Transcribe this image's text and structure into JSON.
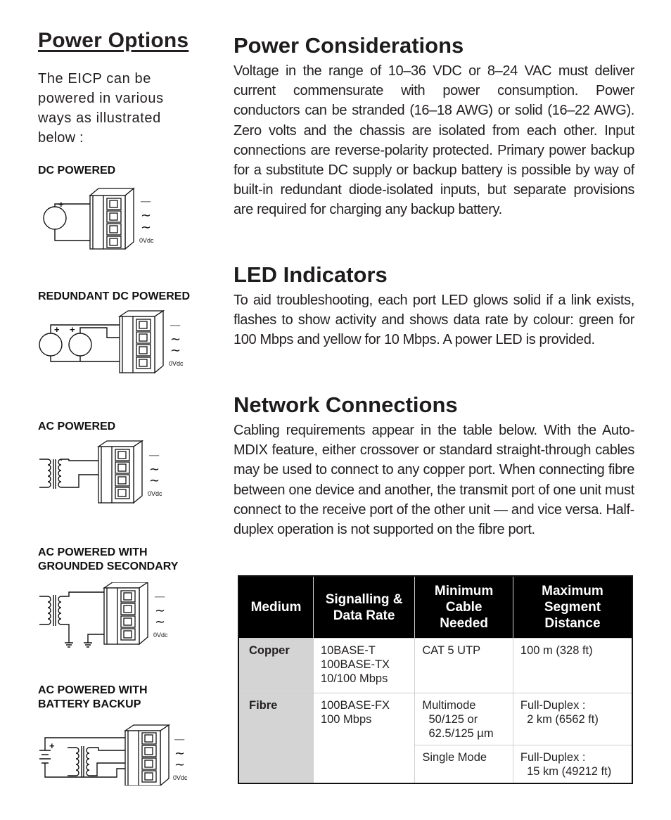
{
  "left": {
    "title": "Power Options",
    "intro_lines": [
      "The EICP can be",
      "powered in various",
      "ways as illustrated",
      "below :"
    ],
    "diagrams": [
      {
        "label_lines": [
          "DC POWERED"
        ],
        "sources": "one DC supply"
      },
      {
        "label_lines": [
          "REDUNDANT DC POWERED"
        ],
        "sources": "two DC supplies"
      },
      {
        "label_lines": [
          "AC POWERED"
        ],
        "sources": "transformer"
      },
      {
        "label_lines": [
          "AC POWERED WITH",
          "GROUNDED SECONDARY"
        ],
        "sources": "transformer with grounds"
      },
      {
        "label_lines": [
          "AC POWERED WITH",
          "BATTERY BACKUP"
        ],
        "sources": "battery and transformer"
      }
    ],
    "terminal_labels": {
      "dc": "──",
      "ac1": "∼",
      "ac2": "∼",
      "zero": "0Vdc"
    },
    "plus_sign": "+"
  },
  "sections": [
    {
      "title": "Power Considerations",
      "body": "Voltage in the range of 10–36 VDC or 8–24 VAC must deliver current commensurate with power consumption. Power conductors can be  stranded (16–18 AWG) or solid (16–22 AWG).  Zero volts and the chassis are isolated from each other.  Input connections are reverse-polarity protected.  Primary power backup for a substitute DC supply or backup battery is possible by way of built-in redundant diode-isolated inputs, but separate provisions are required for charging any backup battery."
    },
    {
      "title": "LED Indicators",
      "body": "To aid troubleshooting, each port LED glows solid if a link exists, flashes to show activity and shows data rate by colour: green for 100 Mbps and yellow for 10 Mbps.  A power LED is provided."
    },
    {
      "title": "Network Connections",
      "body": "Cabling requirements appear in the table below.  With the Auto-MDIX feature, either crossover or standard straight-through cables may be used to connect to any copper port.  When connecting fibre between one device and another, the transmit port of one unit must connect to the receive port of the other unit — and vice versa.  Half-duplex operation is not supported on the fibre port."
    }
  ],
  "table": {
    "headers": [
      "Medium",
      "Signalling &\nData Rate",
      "Minimum\nCable\nNeeded",
      "Maximum\nSegment\nDistance"
    ],
    "rows": {
      "copper": {
        "medium": "Copper",
        "signalling": "10BASE-T\n100BASE-TX\n10/100 Mbps",
        "cable": "CAT 5 UTP",
        "distance": "100 m (328 ft)"
      },
      "fibre": {
        "medium": "Fibre",
        "signalling": "100BASE-FX\n100 Mbps",
        "multimode_cable": "Multimode\n  50/125 or\n  62.5/125 µm",
        "multimode_distance": "Full-Duplex :\n  2 km (6562 ft)",
        "singlemode_cable": "Single Mode",
        "singlemode_distance": "Full-Duplex :\n  15 km (49212 ft)"
      }
    },
    "colors": {
      "header_bg": "#000000",
      "header_text": "#ffffff",
      "medium_bg": "#d4d4d4",
      "grid": "#cfcfcf"
    }
  }
}
